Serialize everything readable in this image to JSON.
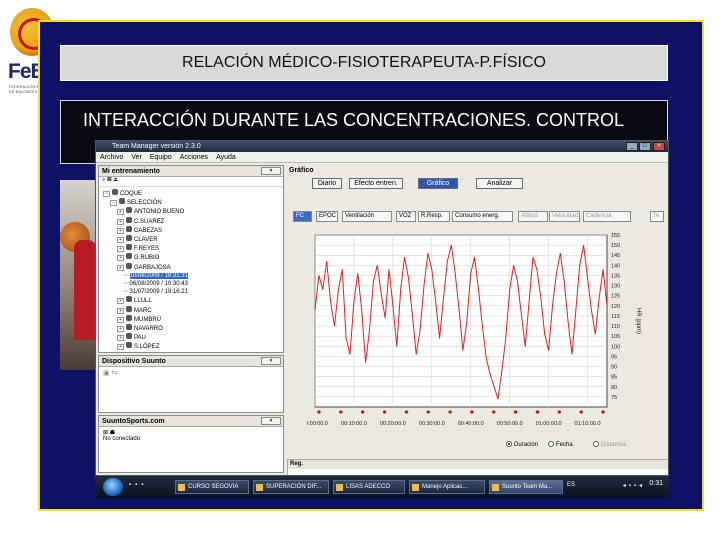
{
  "slide": {
    "title": "RELACIÓN MÉDICO-FISIOTERAPEUTA-P.FÍSICO",
    "subtitle": "INTERACCIÓN DURANTE LAS CONCENTRACIONES. CONTROL"
  },
  "logo": {
    "brand": "FeB",
    "tagline": "FEDERACIÓN ESPAÑOLA DE BALONCESTO"
  },
  "app": {
    "window_title": "Team Manager versión 2.3.0",
    "menu": [
      "Archivo",
      "Ver",
      "Equipo",
      "Acciones",
      "Ayuda"
    ],
    "mi_entrenamiento": {
      "header": "Mi entrenamiento",
      "tree": [
        {
          "label": "COQUE",
          "level": 0
        },
        {
          "label": "SELECCIÓN",
          "level": 1
        },
        {
          "label": "ANTONIO BUENO",
          "level": 2
        },
        {
          "label": "C.SUAREZ",
          "level": 2
        },
        {
          "label": "CABEZAS",
          "level": 2
        },
        {
          "label": "CLAVER",
          "level": 2
        },
        {
          "label": "F.REYES",
          "level": 2
        },
        {
          "label": "G.RUBIO",
          "level": 2
        },
        {
          "label": "GARBAJOSA",
          "level": 2
        },
        {
          "label": "10/08/2009 / 18:31:31",
          "level": 3,
          "selected": true
        },
        {
          "label": "06/08/2009 / 10:30:43",
          "level": 3
        },
        {
          "label": "31/07/2009 / 19:16:21",
          "level": 3
        },
        {
          "label": "LLULL",
          "level": 2
        },
        {
          "label": "MARC",
          "level": 2
        },
        {
          "label": "MUMBRÚ",
          "level": 2
        },
        {
          "label": "NAVARRO",
          "level": 2
        },
        {
          "label": "PAU",
          "level": 2
        },
        {
          "label": "S.LÓPEZ",
          "level": 2
        }
      ]
    },
    "dispositivo": {
      "header": "Dispositivo Suunto"
    },
    "suunto_sports": {
      "header": "SuuntoSports.com",
      "status": "No conectado"
    },
    "grafico": {
      "header": "Gráfico",
      "buttons": [
        "Diario",
        "Efecto entren.",
        "Gráfico",
        "Analizar"
      ],
      "active_button": "Gráfico",
      "tabs": [
        "FC",
        "EPOC",
        "Ventilación",
        "VOZ",
        "R.Resp.",
        "Consumo energ.",
        "Altitud",
        "Velocidad",
        "Cadencia",
        "Te"
      ],
      "active_tab": "FC",
      "radio": [
        {
          "label": "Duración",
          "checked": true
        },
        {
          "label": "Fecha",
          "checked": false
        },
        {
          "label": "Distancia",
          "checked": false,
          "disabled": true
        }
      ]
    },
    "reg": {
      "header": "Reg."
    }
  },
  "taskbar": {
    "buttons": [
      "CURSO SEGOVIA",
      "SUPERACIÓN DIF...",
      "LISAS ADECCO",
      "Manejo Aplicac...",
      "Suunto Team Ma..."
    ],
    "active": "Suunto Team Ma...",
    "clock": "0:31",
    "lang": "ES"
  },
  "chart_data": {
    "type": "line",
    "ylabel": "HR (ppm)",
    "ylim": [
      70,
      155
    ],
    "yticks": [
      75,
      80,
      85,
      90,
      95,
      100,
      105,
      110,
      115,
      120,
      125,
      130,
      135,
      140,
      145,
      150,
      155
    ],
    "xticks": [
      "00:00:00.0",
      "00:10:00.0",
      "00:20:00.0",
      "00:30:00.0",
      "00:40:00.0",
      "00:50:00.0",
      "01:00:00.0",
      "01:10:00.0"
    ],
    "x_range_min": [
      0,
      75
    ],
    "grid": true,
    "color": "#e02020",
    "series": [
      {
        "x": [
          0,
          1,
          2,
          3,
          4,
          5,
          6,
          7,
          8,
          9,
          10,
          11,
          12,
          13,
          14,
          15,
          16,
          17,
          18,
          19,
          20,
          21,
          22,
          23,
          24,
          25,
          26,
          27,
          28,
          29,
          30,
          31,
          32,
          33,
          34,
          35,
          36,
          37,
          38,
          39,
          40,
          41,
          42,
          43,
          44,
          45,
          46,
          47,
          48,
          49,
          50,
          51,
          52,
          53,
          54,
          55,
          56,
          57,
          58,
          59,
          60,
          61,
          62,
          63,
          64,
          65,
          66,
          67,
          68,
          69,
          70,
          71,
          72,
          73,
          74,
          75
        ],
        "values": [
          118,
          135,
          128,
          142,
          122,
          110,
          128,
          138,
          104,
          96,
          122,
          136,
          118,
          92,
          108,
          132,
          140,
          126,
          114,
          138,
          120,
          100,
          128,
          144,
          134,
          116,
          96,
          108,
          130,
          146,
          138,
          122,
          104,
          124,
          142,
          150,
          136,
          118,
          98,
          112,
          136,
          144,
          128,
          110,
          94,
          86,
          80,
          74,
          88,
          104,
          128,
          140,
          132,
          116,
          100,
          122,
          144,
          138,
          124,
          106,
          98,
          120,
          136,
          146,
          132,
          112,
          96,
          118,
          140,
          150,
          134,
          118,
          106,
          124,
          138,
          120
        ]
      }
    ]
  }
}
